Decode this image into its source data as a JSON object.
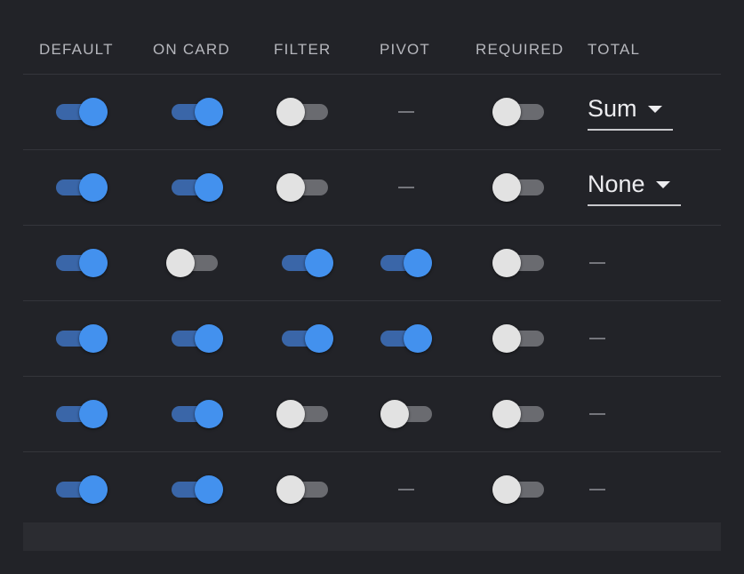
{
  "headers": [
    "DEFAULT",
    "ON CARD",
    "FILTER",
    "PIVOT",
    "REQUIRED",
    "TOTAL"
  ],
  "rows": [
    {
      "default": true,
      "on_card": true,
      "filter": false,
      "pivot": null,
      "required": false,
      "total": "Sum"
    },
    {
      "default": true,
      "on_card": true,
      "filter": false,
      "pivot": null,
      "required": false,
      "total": "None"
    },
    {
      "default": true,
      "on_card": false,
      "filter": true,
      "pivot": true,
      "required": false,
      "total": null
    },
    {
      "default": true,
      "on_card": true,
      "filter": true,
      "pivot": true,
      "required": false,
      "total": null
    },
    {
      "default": true,
      "on_card": true,
      "filter": false,
      "pivot": false,
      "required": false,
      "total": null
    },
    {
      "default": true,
      "on_card": true,
      "filter": false,
      "pivot": null,
      "required": false,
      "total": null
    }
  ],
  "colors": {
    "background": "#222328",
    "switch_on_thumb": "#4391ee",
    "switch_on_track": "#3a66a8",
    "switch_off_thumb": "#e2e2e2",
    "switch_off_track": "#6a6b70"
  }
}
